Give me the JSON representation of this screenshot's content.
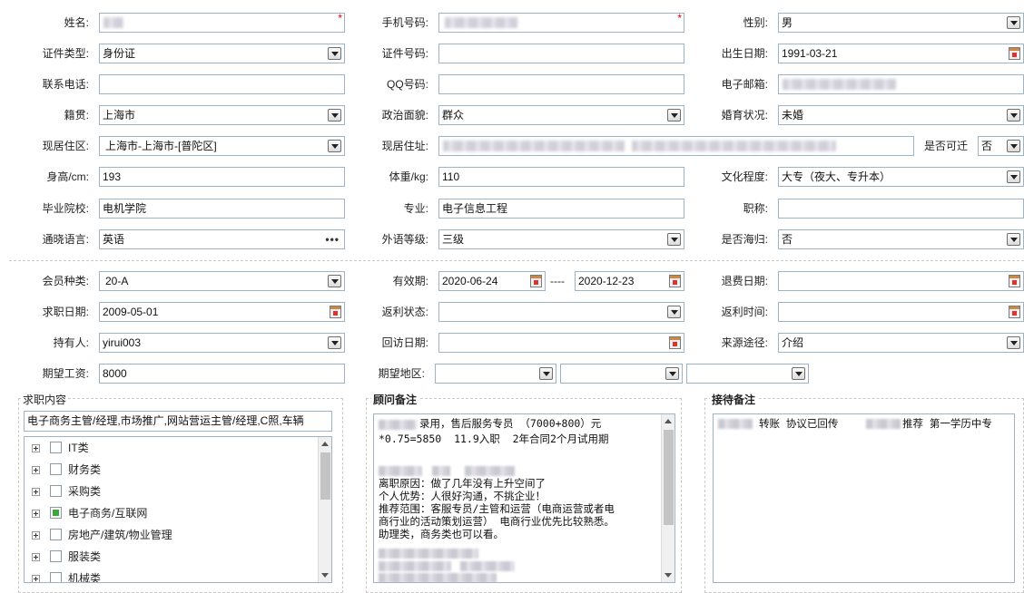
{
  "personal": {
    "name_label": "姓名:",
    "mobile_label": "手机号码:",
    "gender_label": "性别:",
    "gender_value": "男",
    "idtype_label": "证件类型:",
    "idtype_value": "身份证",
    "idno_label": "证件号码:",
    "birth_label": "出生日期:",
    "birth_value": "1991-03-21",
    "phone_label": "联系电话:",
    "qq_label": "QQ号码:",
    "email_label": "电子邮箱:",
    "native_label": "籍贯:",
    "native_value": "上海市",
    "political_label": "政治面貌:",
    "political_value": "群众",
    "marital_label": "婚育状况:",
    "marital_value": "未婚",
    "area_label": "现居住区:",
    "area_value": "上海市-上海市-[普陀区]",
    "address_label": "现居住址:",
    "relocate_label": "是否可迁",
    "relocate_value": "否",
    "height_label": "身高/cm:",
    "height_value": "193",
    "weight_label": "体重/kg:",
    "weight_value": "110",
    "edu_label": "文化程度:",
    "edu_value": "大专（夜大、专升本）",
    "school_label": "毕业院校:",
    "school_value": "电机学院",
    "major_label": "专业:",
    "major_value": "电子信息工程",
    "title_label": "职称:",
    "lang_label": "通晓语言:",
    "lang_value": "英语",
    "lang_more": "•••",
    "level_label": "外语等级:",
    "level_value": "三级",
    "overseas_label": "是否海归:",
    "overseas_value": "否",
    "required_mark": "*"
  },
  "membership": {
    "type_label": "会员种类:",
    "type_value": "20-A",
    "valid_label": "有效期:",
    "valid_from": "2020-06-24",
    "valid_sep": "----",
    "valid_to": "2020-12-23",
    "refund_date_label": "退费日期:",
    "jobsearch_label": "求职日期:",
    "jobsearch_value": "2009-05-01",
    "rebate_status_label": "返利状态:",
    "rebate_time_label": "返利时间:",
    "holder_label": "持有人:",
    "holder_value": "yirui003",
    "revisit_label": "回访日期:",
    "source_label": "来源途径:",
    "source_value": "介绍",
    "salary_label": "期望工资:",
    "salary_value": "8000",
    "region_label": "期望地区:"
  },
  "job": {
    "group_title": "求职内容",
    "selected_text": "电子商务主管/经理,市场推广,网站营运主管/经理,C照,车辆",
    "tree": [
      {
        "label": "IT类",
        "checked": false
      },
      {
        "label": "财务类",
        "checked": false
      },
      {
        "label": "采购类",
        "checked": false
      },
      {
        "label": "电子商务/互联网",
        "checked": true
      },
      {
        "label": "房地产/建筑/物业管理",
        "checked": false
      },
      {
        "label": "服装类",
        "checked": false
      },
      {
        "label": "机械类",
        "checked": false
      }
    ]
  },
  "advisor": {
    "group_title": "顾问备注",
    "lines": [
      "录用，售后服务专员 （7000+800）元",
      "*0.75=5850  11.9入职  2年合同2个月试用期",
      "",
      "",
      "离职原因：做了几年没有上升空间了",
      "个人优势：人很好沟通，不挑企业！",
      "推荐范围：客服专员/主管和运营（电商运营或者电",
      "商行业的活动策划运营） 电商行业优先比较熟悉。",
      "助理类，商务类也可以看。"
    ]
  },
  "reception": {
    "group_title": "接待备注",
    "line_part1": "转账 协议已回传",
    "line_part2": "推荐 第一学历中专"
  },
  "colors": {
    "border": "#9db3c8",
    "required": "#e00000",
    "checked": "#3aa83a"
  }
}
